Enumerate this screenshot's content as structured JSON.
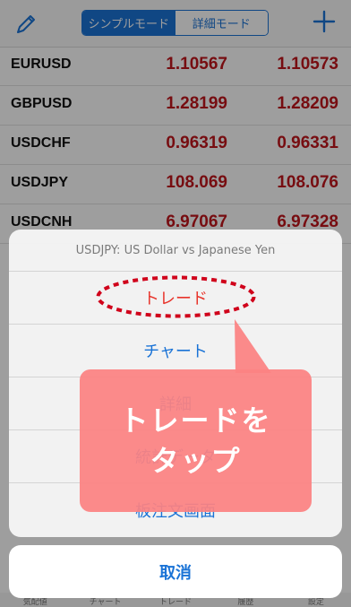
{
  "header": {
    "segment_simple": "シンプルモード",
    "segment_detail": "詳細モード"
  },
  "quotes": [
    {
      "symbol": "EURUSD",
      "bid": "1.10567",
      "ask": "1.10573"
    },
    {
      "symbol": "GBPUSD",
      "bid": "1.28199",
      "ask": "1.28209"
    },
    {
      "symbol": "USDCHF",
      "bid": "0.96319",
      "ask": "0.96331"
    },
    {
      "symbol": "USDJPY",
      "bid": "108.069",
      "ask": "108.076"
    },
    {
      "symbol": "USDCNH",
      "bid": "6.97067",
      "ask": "6.97328"
    }
  ],
  "tabbar": {
    "items": [
      "気配値",
      "チャート",
      "トレード",
      "履歴",
      "設定"
    ]
  },
  "action_sheet": {
    "title": "USDJPY: US Dollar vs Japanese Yen",
    "items": [
      "トレード",
      "チャート",
      "詳細",
      "統計データ",
      "板注文画面"
    ],
    "cancel": "取消"
  },
  "annotation": {
    "callout_text": "トレードを\nタップ"
  },
  "colors": {
    "accent_blue": "#1a73d6",
    "price_red": "#c0161c",
    "highlight_red": "#e8342b",
    "callout_pink": "#fc8282"
  },
  "icons": {
    "edit": "pencil-icon",
    "add": "plus-icon"
  }
}
